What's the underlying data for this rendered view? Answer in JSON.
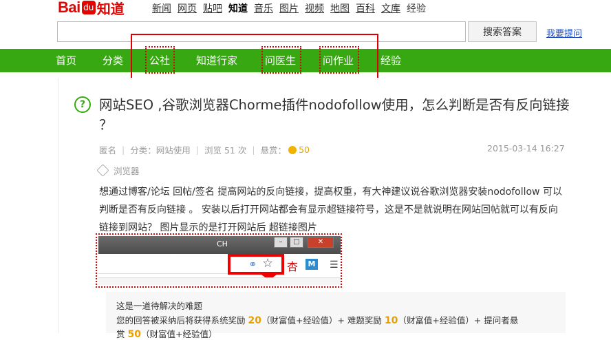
{
  "logo": {
    "bai": "Bai",
    "paw": "du",
    "zhidao": "知道"
  },
  "topnav": [
    {
      "label": "新闻",
      "style": "link"
    },
    {
      "label": "网页",
      "style": "link"
    },
    {
      "label": "贴吧",
      "style": "link"
    },
    {
      "label": "知道",
      "style": "active"
    },
    {
      "label": "音乐",
      "style": "link"
    },
    {
      "label": "图片",
      "style": "link"
    },
    {
      "label": "视频",
      "style": "link"
    },
    {
      "label": "地图",
      "style": "link"
    },
    {
      "label": "百科",
      "style": "link"
    },
    {
      "label": "文库",
      "style": "link"
    },
    {
      "label": "经验",
      "style": "muted"
    }
  ],
  "search": {
    "value": "",
    "button_label": "搜索答案",
    "ask_link": "我要提问"
  },
  "greennav": {
    "items": [
      "首页",
      "分类",
      "公社",
      "知道行家",
      "问医生",
      "问作业",
      "经验"
    ],
    "highlighted": [
      "公社",
      "问医生",
      "问作业"
    ]
  },
  "question": {
    "title": "网站SEO ,谷歌浏览器Chorme插件nodofollow使用，怎么判断是否有反向链接 ？",
    "author": "匿名",
    "category": "分类：网站使用",
    "views": "浏览 51 次",
    "bounty_label": "悬赏：",
    "bounty_value": "50",
    "date": "2015-03-14 16:27",
    "tag": "浏览器",
    "body": "想通过博客/论坛 回帖/签名 提高网站的反向链接，提高权重，有大神建议说谷歌浏览器安装nodofollow 可以判断是否有反向链接 。   安装以后打开网站都会有显示超链接符号，这是不是就说明在网站回帖就可以有反向链接到网站？ 图片显示的是打开网站后 超链接图片"
  },
  "screenshot": {
    "bar_text": "CH",
    "char": "杏",
    "m_icon": "M"
  },
  "notice": {
    "line1": "这是一道待解决的难题",
    "line2_a": "您的回答被采纳后将获得系统奖励 ",
    "reward1": "20",
    "line2_b": "（财富值+经验值）+ 难题奖励 ",
    "reward2": "10",
    "line2_c": "（财富值+经验值）+ 提问者悬",
    "line3_a": "赏 ",
    "reward3": "50",
    "line3_b": "（财富值+经验值）"
  },
  "colors": {
    "brand_red": "#e10602",
    "nav_green": "#38a812",
    "bounty": "#e6a100",
    "link_blue": "#1f4bbd"
  }
}
